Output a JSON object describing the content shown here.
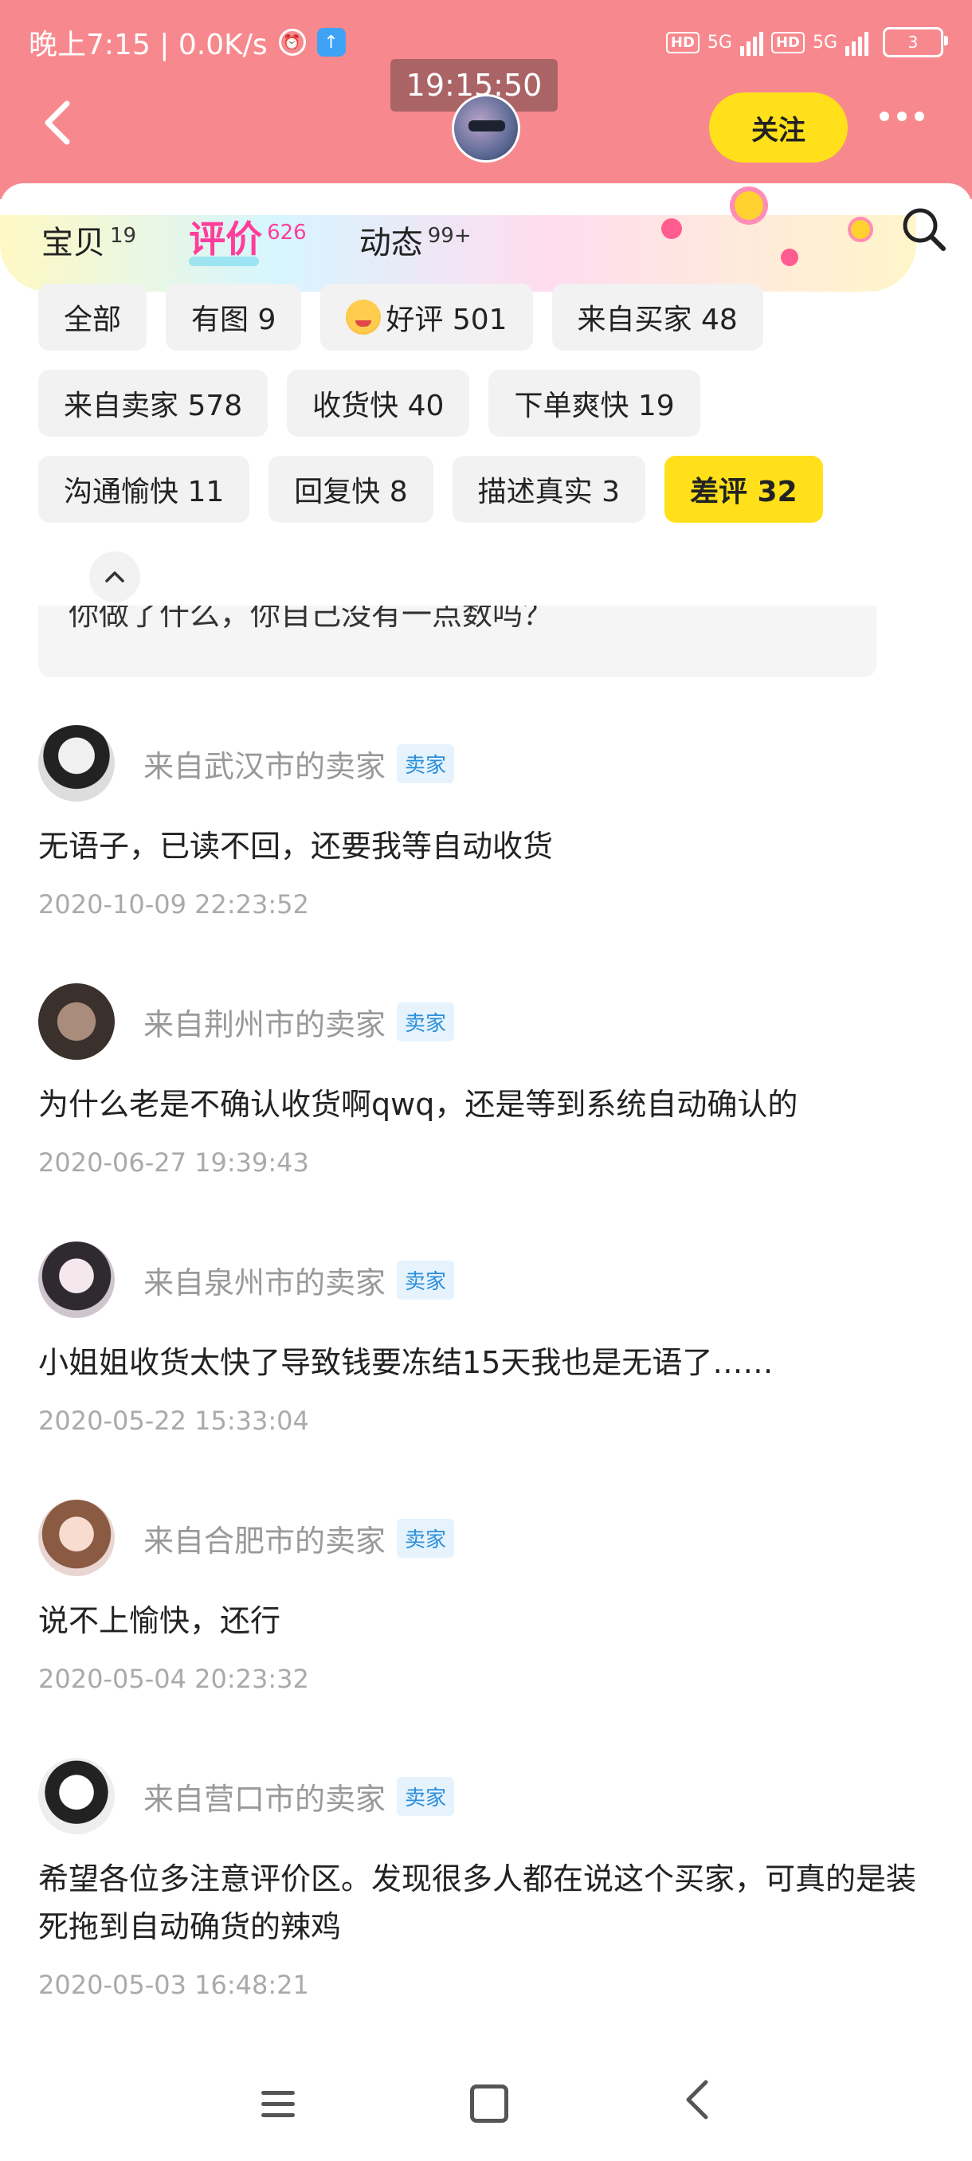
{
  "status_bar": {
    "time_net": "晚上7:15 | 0.0K/s",
    "hd1": "HD",
    "net1": "5G",
    "hd2": "HD",
    "net2": "5G",
    "battery": "3"
  },
  "header": {
    "timer": "19:15:50",
    "back_icon": "chevron-left-icon",
    "follow_label": "关注",
    "more_icon": "more-dots-icon"
  },
  "tabs": [
    {
      "label": "宝贝",
      "count": "19"
    },
    {
      "label": "评价",
      "count": "626"
    },
    {
      "label": "动态",
      "count": "99+"
    }
  ],
  "active_tab": "评价",
  "filters": [
    {
      "label": "全部"
    },
    {
      "label": "有图 9"
    },
    {
      "label": "好评 501"
    },
    {
      "label": "来自买家 48"
    },
    {
      "label": "来自卖家 578"
    },
    {
      "label": "收货快 40"
    },
    {
      "label": "下单爽快 19"
    },
    {
      "label": "沟通愉快 11"
    },
    {
      "label": "回复快 8"
    },
    {
      "label": "描述真实 3"
    },
    {
      "label": "差评 32"
    }
  ],
  "selected_filter": "差评 32",
  "partial_review_text": "你做了什么，你自己没有一点数吗？",
  "reviews": [
    {
      "name": "来自武汉市的卖家",
      "tag": "卖家",
      "text": "无语子，已读不回，还要我等自动收货",
      "time": "2020-10-09 22:23:52"
    },
    {
      "name": "来自荆州市的卖家",
      "tag": "卖家",
      "text": "为什么老是不确认收货啊qwq，还是等到系统自动确认的",
      "time": "2020-06-27 19:39:43"
    },
    {
      "name": "来自泉州市的卖家",
      "tag": "卖家",
      "text": "小姐姐收货太快了导致钱要冻结15天我也是无语了……",
      "time": "2020-05-22 15:33:04"
    },
    {
      "name": "来自合肥市的卖家",
      "tag": "卖家",
      "text": "说不上愉快，还行",
      "time": "2020-05-04 20:23:32"
    },
    {
      "name": "来自营口市的卖家",
      "tag": "卖家",
      "text": "希望各位多注意评价区。发现很多人都在说这个买家，可真的是装死拖到自动确货的辣鸡",
      "time": "2020-05-03 16:48:21"
    }
  ],
  "colors": {
    "header_bg": "#f7898e",
    "accent_yellow": "#ffe01a",
    "active_tab": "#ff3d9a",
    "seller_tag": "#2b8fdb"
  }
}
